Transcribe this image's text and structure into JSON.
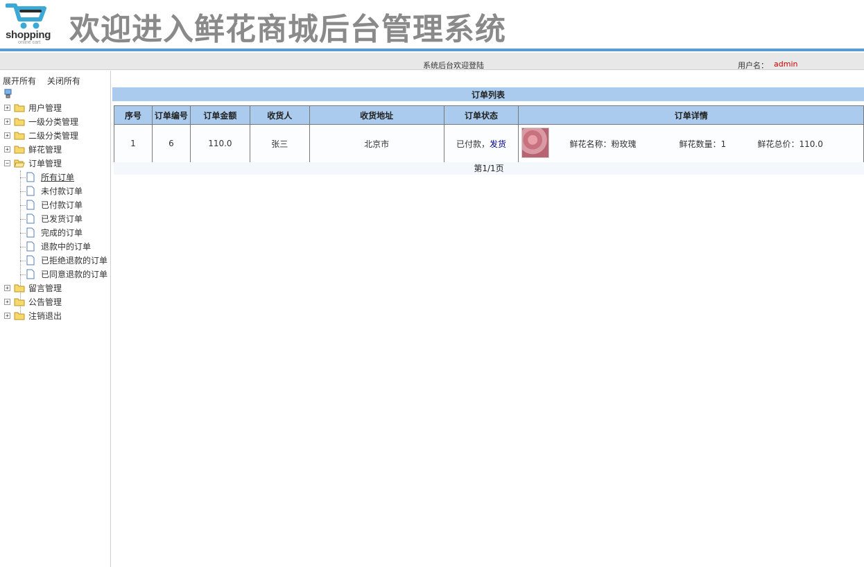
{
  "header": {
    "logo_text": "shopping",
    "logo_sub": "online cart",
    "site_title": "欢迎进入鲜花商城后台管理系统"
  },
  "infobar": {
    "welcome": "系统后台欢迎登陆",
    "user_label": "用户名：",
    "user_name": "admin"
  },
  "sidebar": {
    "expand_all": "展开所有",
    "collapse_all": "关闭所有",
    "groups": [
      {
        "label": "用户管理",
        "expander": "+"
      },
      {
        "label": "一级分类管理",
        "expander": "+"
      },
      {
        "label": "二级分类管理",
        "expander": "+"
      },
      {
        "label": "鲜花管理",
        "expander": "+"
      },
      {
        "label": "订单管理",
        "expander": "−"
      },
      {
        "label": "留言管理",
        "expander": "+"
      },
      {
        "label": "公告管理",
        "expander": "+"
      },
      {
        "label": "注销退出",
        "expander": "+"
      }
    ],
    "order_items": [
      "所有订单",
      "未付款订单",
      "已付款订单",
      "已发货订单",
      "完成的订单",
      "退款中的订单",
      "已拒绝退款的订单",
      "已同意退款的订单"
    ]
  },
  "main": {
    "list_title": "订单列表",
    "columns": [
      "序号",
      "订单编号",
      "订单金额",
      "收货人",
      "收货地址",
      "订单状态",
      "订单详情"
    ],
    "rows": [
      {
        "index": "1",
        "order_no": "6",
        "amount": "110.0",
        "receiver": "张三",
        "address": "北京市",
        "status": "已付款，",
        "status_action": "发货",
        "detail_name": "鲜花名称：粉玫瑰",
        "detail_qty": "鲜花数量：1",
        "detail_total": "鲜花总价：110.0"
      }
    ],
    "pager": "第1/1页"
  },
  "colors": {
    "accent_blue": "#5b9bd5",
    "table_header": "#aacbed",
    "user_name_red": "#cc0000",
    "title_gray": "#8a8a8a"
  }
}
